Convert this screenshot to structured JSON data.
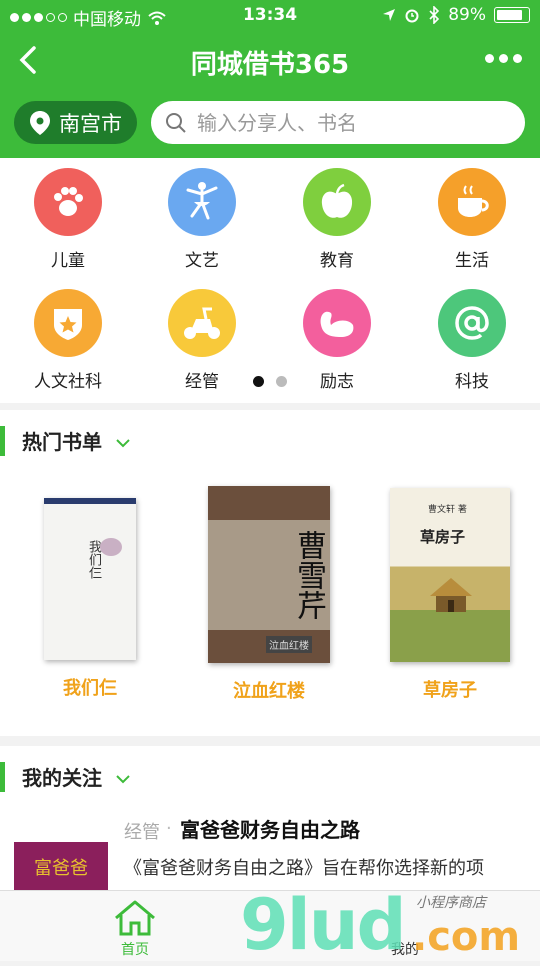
{
  "status": {
    "carrier": "中国移动",
    "time": "13:34",
    "battery": "89%",
    "battery_level": 0.89
  },
  "nav": {
    "title": "同城借书365"
  },
  "location": {
    "city": "南宫市"
  },
  "search": {
    "placeholder": "输入分享人、书名"
  },
  "categories": [
    {
      "label": "儿童",
      "color": "#f0605c",
      "icon": "paw-icon"
    },
    {
      "label": "文艺",
      "color": "#6aa8f0",
      "icon": "dancer-icon"
    },
    {
      "label": "教育",
      "color": "#7fcf3e",
      "icon": "apple-icon"
    },
    {
      "label": "生活",
      "color": "#f5a02a",
      "icon": "cup-icon"
    },
    {
      "label": "人文社科",
      "color": "#f7a934",
      "icon": "badge-icon"
    },
    {
      "label": "经管",
      "color": "#f8c93a",
      "icon": "scooter-icon"
    },
    {
      "label": "励志",
      "color": "#f35f9d",
      "icon": "muscle-icon"
    },
    {
      "label": "科技",
      "color": "#4dc77b",
      "icon": "at-icon"
    }
  ],
  "pager": {
    "count": 2,
    "active": 0
  },
  "hot": {
    "title": "热门书单",
    "books": [
      {
        "name": "我们仨",
        "cover_text": "我们仨"
      },
      {
        "name": "泣血红楼",
        "cover_text": "曹雪芹",
        "cover_sub": "泣血红楼"
      },
      {
        "name": "草房子",
        "cover_text": "草房子",
        "cover_author": "曹文轩 著"
      }
    ]
  },
  "follow": {
    "title": "我的关注",
    "items": [
      {
        "tag": "经管",
        "sep": "·",
        "book": "富爸爸财务自由之路",
        "desc": "《富爸爸财务自由之路》旨在帮你选择新的项",
        "thumb": "富爸爸"
      }
    ]
  },
  "tabs": [
    {
      "label": "首页",
      "active": true
    },
    {
      "label": "我的",
      "active": false
    }
  ],
  "watermark": {
    "text": "9lud",
    "dot": ".com",
    "script": "小程序商店"
  }
}
